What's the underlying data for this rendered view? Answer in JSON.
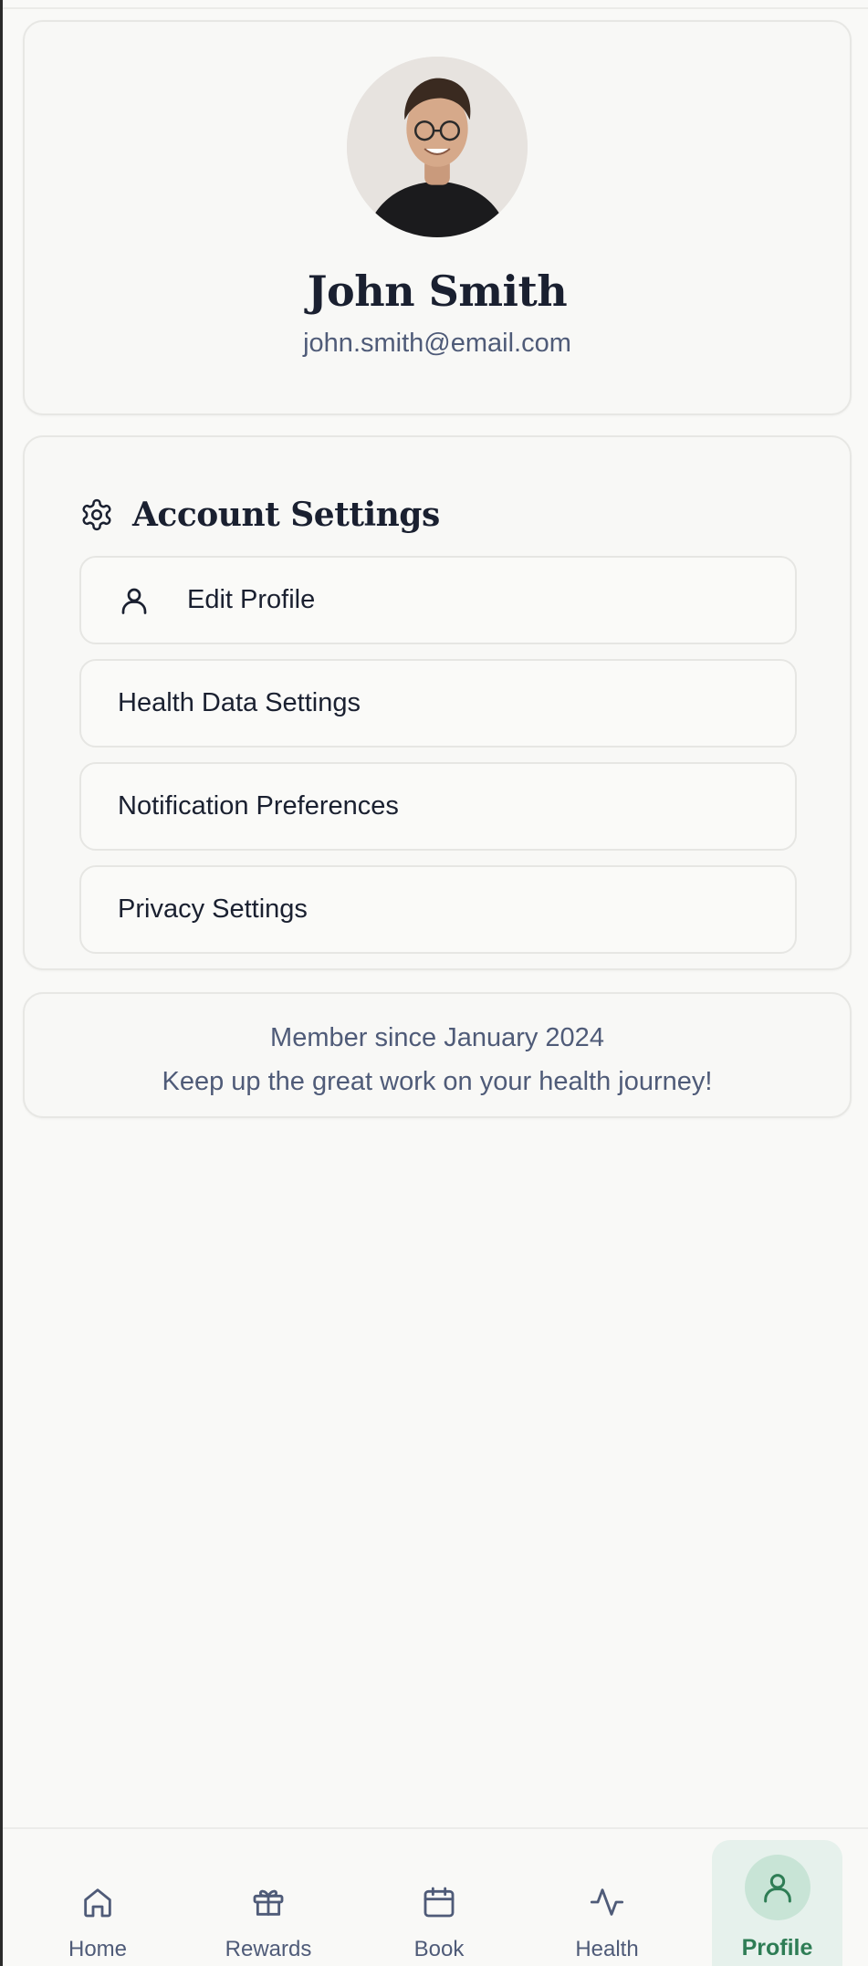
{
  "profile": {
    "name": "John Smith",
    "email": "john.smith@email.com",
    "avatar_alt": "User avatar"
  },
  "account_settings": {
    "title": "Account Settings",
    "icon": "gear-icon",
    "items": [
      {
        "label": "Edit Profile",
        "icon": "user-icon"
      },
      {
        "label": "Health Data Settings"
      },
      {
        "label": "Notification Preferences"
      },
      {
        "label": "Privacy Settings"
      }
    ]
  },
  "membership": {
    "since": "Member since January 2024",
    "message": "Keep up the great work on your health journey!"
  },
  "bottom_nav": {
    "items": [
      {
        "label": "Home",
        "icon": "home-icon"
      },
      {
        "label": "Rewards",
        "icon": "gift-icon"
      },
      {
        "label": "Book",
        "icon": "calendar-icon"
      },
      {
        "label": "Health",
        "icon": "activity-icon"
      },
      {
        "label": "Profile",
        "icon": "user-icon",
        "active": true
      }
    ]
  },
  "colors": {
    "background": "#f9f9f7",
    "text_primary": "#1a2030",
    "text_secondary": "#4f5b78",
    "accent": "#2e7d55",
    "active_bg": "#e6f1ec"
  }
}
